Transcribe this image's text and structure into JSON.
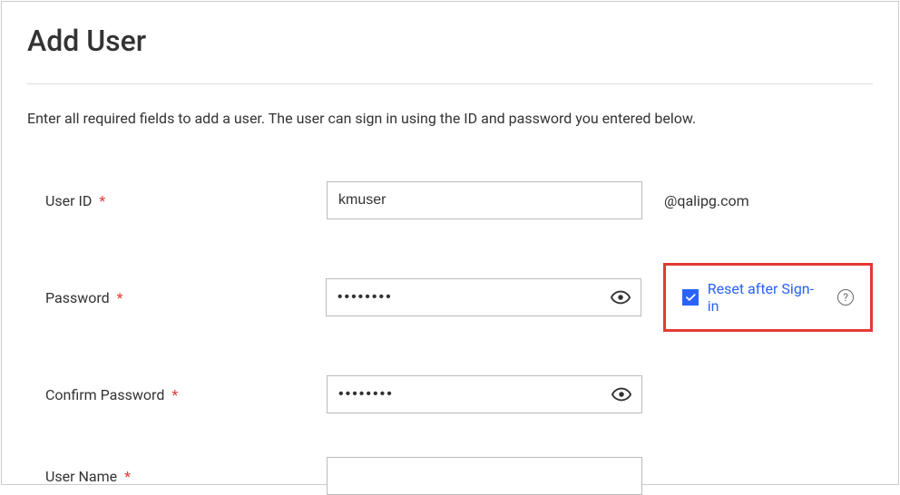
{
  "page": {
    "title": "Add User",
    "description": "Enter all required fields to add a user. The user can sign in using the ID and password you entered below."
  },
  "form": {
    "userId": {
      "label": "User ID",
      "value": "kmuser",
      "domain": "@qalipg.com"
    },
    "password": {
      "label": "Password",
      "value": "••••••••"
    },
    "confirmPassword": {
      "label": "Confirm Password",
      "value": "••••••••"
    },
    "userName": {
      "label": "User Name",
      "value": ""
    },
    "resetAfterSignIn": {
      "label": "Reset after Sign-in",
      "checked": true
    },
    "requiredMark": "*"
  }
}
